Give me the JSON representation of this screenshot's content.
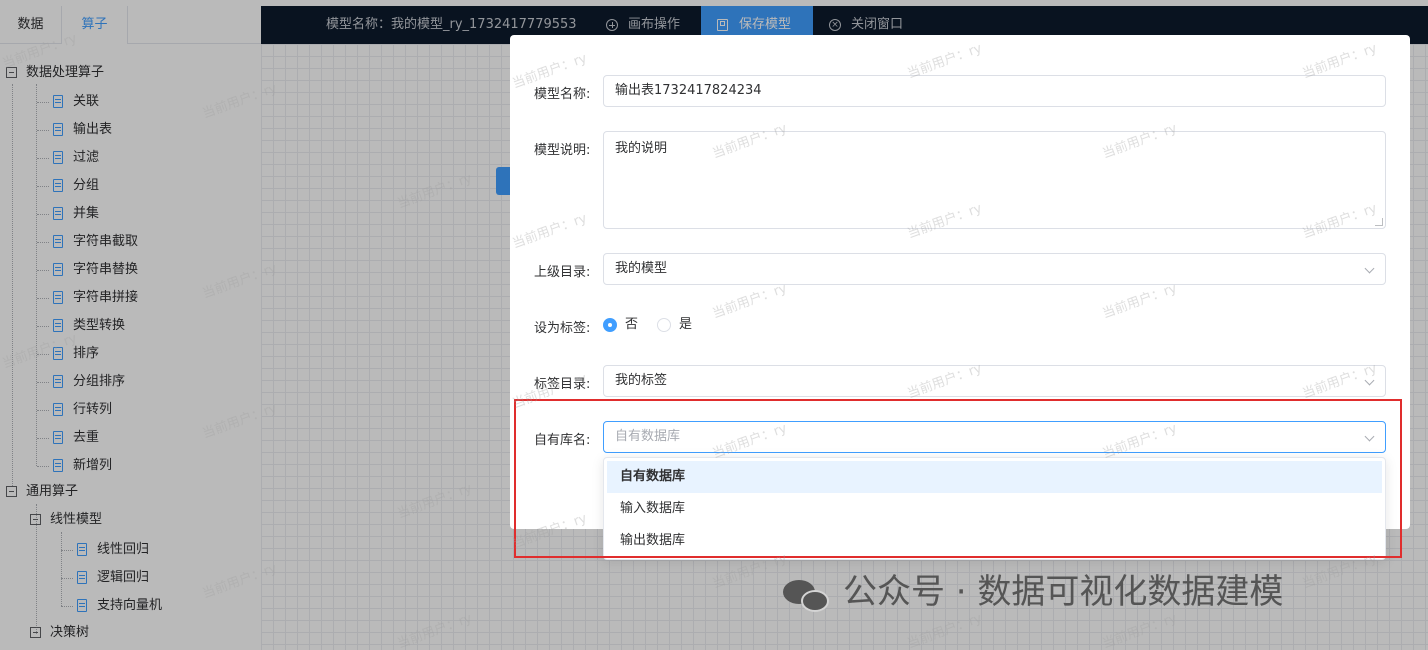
{
  "left_panel": {
    "tabs": [
      "数据",
      "算子"
    ],
    "active_tab": "算子",
    "tree": [
      {
        "label": "数据处理算子",
        "level": 0,
        "type": "group"
      },
      {
        "label": "关联",
        "level": 1,
        "type": "leaf"
      },
      {
        "label": "输出表",
        "level": 1,
        "type": "leaf"
      },
      {
        "label": "过滤",
        "level": 1,
        "type": "leaf"
      },
      {
        "label": "分组",
        "level": 1,
        "type": "leaf"
      },
      {
        "label": "并集",
        "level": 1,
        "type": "leaf"
      },
      {
        "label": "字符串截取",
        "level": 1,
        "type": "leaf"
      },
      {
        "label": "字符串替换",
        "level": 1,
        "type": "leaf"
      },
      {
        "label": "字符串拼接",
        "level": 1,
        "type": "leaf"
      },
      {
        "label": "类型转换",
        "level": 1,
        "type": "leaf"
      },
      {
        "label": "排序",
        "level": 1,
        "type": "leaf"
      },
      {
        "label": "分组排序",
        "level": 1,
        "type": "leaf"
      },
      {
        "label": "行转列",
        "level": 1,
        "type": "leaf"
      },
      {
        "label": "去重",
        "level": 1,
        "type": "leaf"
      },
      {
        "label": "新增列",
        "level": 1,
        "type": "leaf"
      },
      {
        "label": "通用算子",
        "level": 0,
        "type": "group"
      },
      {
        "label": "线性模型",
        "level": 1,
        "type": "group"
      },
      {
        "label": "线性回归",
        "level": 2,
        "type": "leaf"
      },
      {
        "label": "逻辑回归",
        "level": 2,
        "type": "leaf"
      },
      {
        "label": "支持向量机",
        "level": 2,
        "type": "leaf"
      },
      {
        "label": "决策树",
        "level": 1,
        "type": "group"
      }
    ]
  },
  "topbar": {
    "model_title": "模型名称：我的模型_ry_1732417779553",
    "canvas_ops": "画布操作",
    "save_model": "保存模型",
    "close_window": "关闭窗口"
  },
  "dialog": {
    "fields": {
      "name_label": "模型名称:",
      "name_value": "输出表1732417824234",
      "desc_label": "模型说明:",
      "desc_value": "我的说明",
      "parent_label": "上级目录:",
      "parent_value": "我的模型",
      "tag_label": "设为标签:",
      "tag_no": "否",
      "tag_yes": "是",
      "tag_selected": "否",
      "tagdir_label": "标签目录:",
      "tagdir_value": "我的标签",
      "db_label": "自有库名:",
      "db_placeholder": "自有数据库"
    },
    "dropdown_options": [
      "自有数据库",
      "输入数据库",
      "输出数据库"
    ],
    "dropdown_highlighted": "自有数据库"
  },
  "watermark_text": "当前用户：ry",
  "caption": "公众号 · 数据可视化数据建模",
  "colors": {
    "accent": "#409eff",
    "topbar_bg": "#0d1b2d",
    "highlight_red": "#e02d2d"
  }
}
